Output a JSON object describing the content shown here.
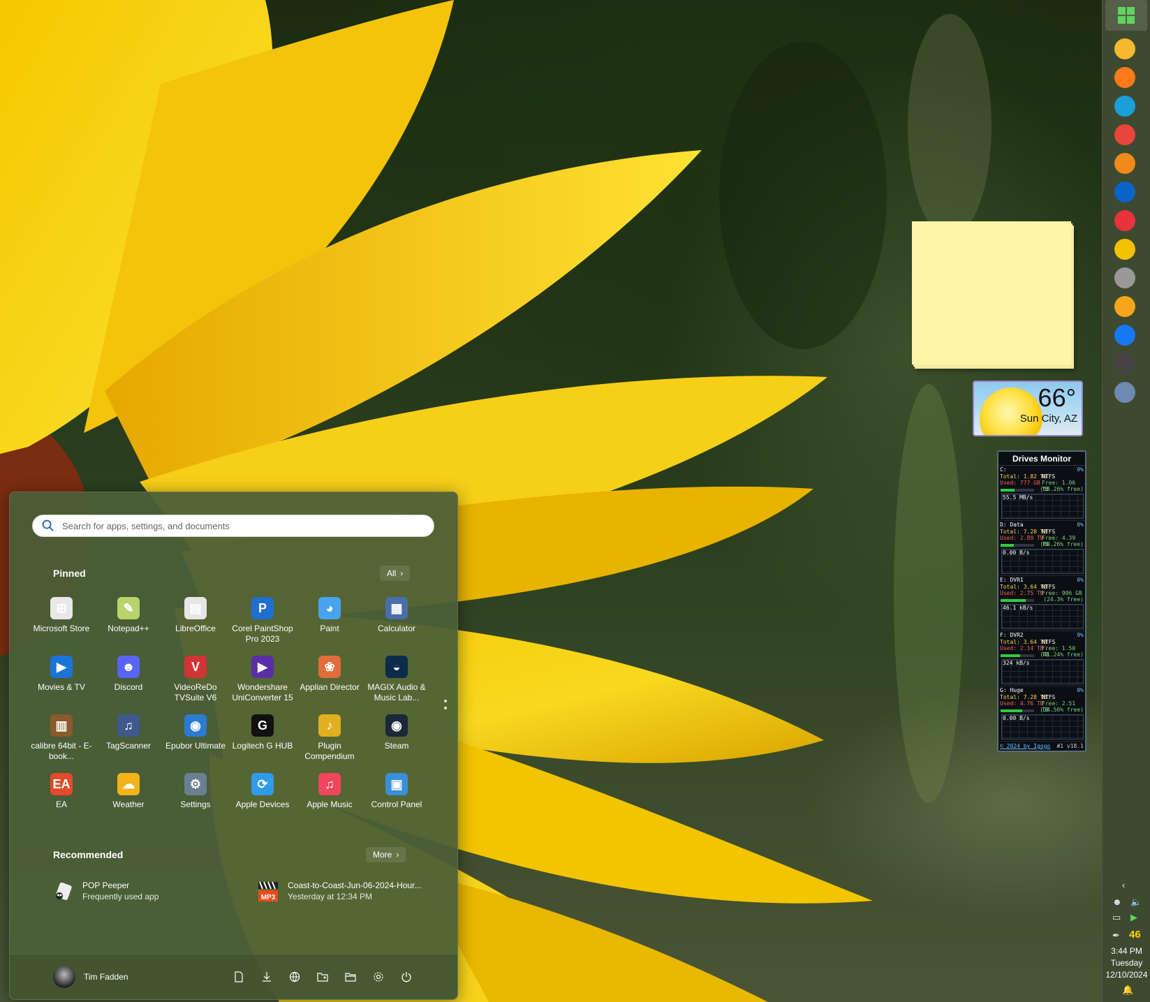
{
  "search": {
    "placeholder": "Search for apps, settings, and documents"
  },
  "pinned": {
    "title": "Pinned",
    "all_label": "All",
    "apps": [
      {
        "label": "Microsoft Store",
        "icon": "microsoft-store-icon",
        "color": "#e8e8e8",
        "glyph": "⊞"
      },
      {
        "label": "Notepad++",
        "icon": "notepad-plus-plus-icon",
        "color": "#b9d36b",
        "glyph": "✎"
      },
      {
        "label": "LibreOffice",
        "icon": "libreoffice-icon",
        "color": "#e6e6e6",
        "glyph": "▤"
      },
      {
        "label": "Corel PaintShop Pro 2023",
        "icon": "paintshop-pro-icon",
        "color": "#1f6fd1",
        "glyph": "P"
      },
      {
        "label": "Paint",
        "icon": "paint-icon",
        "color": "#4aa3ee",
        "glyph": "◕"
      },
      {
        "label": "Calculator",
        "icon": "calculator-icon",
        "color": "#4a6ea8",
        "glyph": "▦"
      },
      {
        "label": "Movies & TV",
        "icon": "movies-tv-icon",
        "color": "#1a73d8",
        "glyph": "▶"
      },
      {
        "label": "Discord",
        "icon": "discord-icon",
        "color": "#5865f2",
        "glyph": "☻"
      },
      {
        "label": "VideoReDo TVSuite V6",
        "icon": "videoredo-icon",
        "color": "#d03434",
        "glyph": "V"
      },
      {
        "label": "Wondershare UniConverter 15",
        "icon": "uniconverter-icon",
        "color": "#5b2ea6",
        "glyph": "▶"
      },
      {
        "label": "Applian Director",
        "icon": "applian-director-icon",
        "color": "#e36c3c",
        "glyph": "❀"
      },
      {
        "label": "MAGIX Audio & Music Lab...",
        "icon": "magix-icon",
        "color": "#0d2b4a",
        "glyph": "◒"
      },
      {
        "label": "calibre 64bit - E-book...",
        "icon": "calibre-icon",
        "color": "#8a5a2b",
        "glyph": "▥"
      },
      {
        "label": "TagScanner",
        "icon": "tagscanner-icon",
        "color": "#3d5a8c",
        "glyph": "♫"
      },
      {
        "label": "Epubor Ultimate",
        "icon": "epubor-icon",
        "color": "#2a7bd1",
        "glyph": "◉"
      },
      {
        "label": "Logitech G HUB",
        "icon": "logitech-ghub-icon",
        "color": "#111111",
        "glyph": "G"
      },
      {
        "label": "Plugin Compendium",
        "icon": "plugin-compendium-icon",
        "color": "#e0b020",
        "glyph": "♪"
      },
      {
        "label": "Steam",
        "icon": "steam-icon",
        "color": "#1b2838",
        "glyph": "◉"
      },
      {
        "label": "EA",
        "icon": "ea-icon",
        "color": "#e14a2a",
        "glyph": "EA"
      },
      {
        "label": "Weather",
        "icon": "weather-icon",
        "color": "#f2b21c",
        "glyph": "☁"
      },
      {
        "label": "Settings",
        "icon": "settings-icon",
        "color": "#6b7f93",
        "glyph": "⚙"
      },
      {
        "label": "Apple Devices",
        "icon": "apple-devices-icon",
        "color": "#2f9be8",
        "glyph": "⟳"
      },
      {
        "label": "Apple Music",
        "icon": "apple-music-icon",
        "color": "#f0455a",
        "glyph": "♫"
      },
      {
        "label": "Control Panel",
        "icon": "control-panel-icon",
        "color": "#3a8fd8",
        "glyph": "▣"
      }
    ]
  },
  "recommended": {
    "title": "Recommended",
    "more_label": "More",
    "items": [
      {
        "name": "POP Peeper",
        "sub": "Frequently used app"
      },
      {
        "name": "Coast-to-Coast-Jun-06-2024-Hour...",
        "sub": "Yesterday at 12:34 PM"
      }
    ]
  },
  "user": {
    "name": "Tim Fadden"
  },
  "weather_widget": {
    "temp": "66°",
    "city": "Sun City, AZ"
  },
  "drives_monitor": {
    "title": "Drives Monitor",
    "drives": [
      {
        "name": "C:",
        "pct": "0%",
        "total": "Total: 1.82 TB",
        "fs": "NTFS",
        "used": "Used: 777 GB",
        "free": "Free: 1.06 TB",
        "free_pct": "(58.26% free)",
        "rate": "55.5 MB/s",
        "used_frac": 0.42
      },
      {
        "name": "D: Data",
        "pct": "0%",
        "total": "Total: 7.28 TB",
        "fs": "NTFS",
        "used": "Used: 2.89 TB",
        "free": "Free: 4.39 TB",
        "free_pct": "(60.26% free)",
        "rate": "0.00 B/s",
        "used_frac": 0.4
      },
      {
        "name": "E: DVR1",
        "pct": "0%",
        "total": "Total: 3.64 TB",
        "fs": "NTFS",
        "used": "Used: 2.75 TB",
        "free": "Free: 906 GB",
        "free_pct": "(24.3% free)",
        "rate": "46.1 kB/s",
        "used_frac": 0.76
      },
      {
        "name": "F: DVR2",
        "pct": "0%",
        "total": "Total: 3.64 TB",
        "fs": "NTFS",
        "used": "Used: 2.14 TB",
        "free": "Free: 1.50 TB",
        "free_pct": "(41.24% free)",
        "rate": "324 kB/s",
        "used_frac": 0.59
      },
      {
        "name": "G: Huge",
        "pct": "0%",
        "total": "Total: 7.28 TB",
        "fs": "NTFS",
        "used": "Used: 4.76 TB",
        "free": "Free: 2.51 TB",
        "free_pct": "(34.56% free)",
        "rate": "0.00 B/s",
        "used_frac": 0.65
      }
    ],
    "footer": "© 2024 by Igogo",
    "version": "#1 v18.1"
  },
  "tray": {
    "badge": "46",
    "time": "3:44 PM",
    "day": "Tuesday",
    "date": "12/10/2024"
  },
  "taskbar_apps": [
    "file-explorer-icon",
    "firefox-icon",
    "edge-icon",
    "chrome-icon",
    "mail-icon",
    "outlook-icon",
    "q-app-icon",
    "quill-icon",
    "pop-peeper-icon",
    "weather-taskbar-icon",
    "facebook-icon",
    "mpc-be-icon",
    "photo-app-icon"
  ]
}
